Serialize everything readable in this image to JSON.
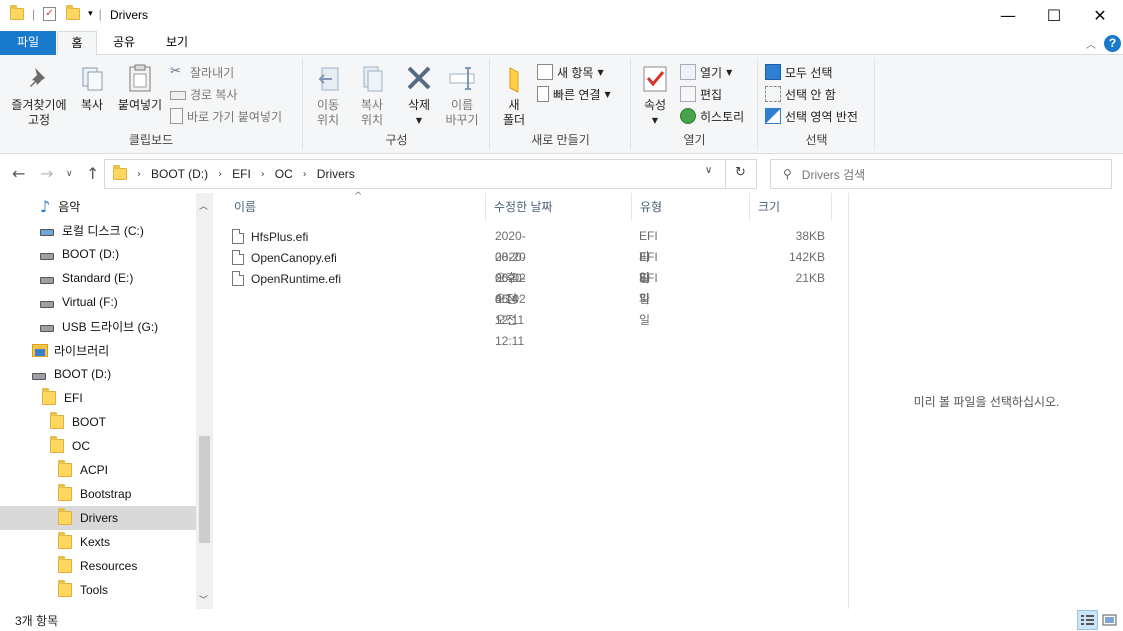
{
  "window": {
    "title": "Drivers",
    "minimize_glyph": "—",
    "maximize_glyph": "☐",
    "close_glyph": "✕"
  },
  "tabs": [
    {
      "label": "파일"
    },
    {
      "label": "홈"
    },
    {
      "label": "공유"
    },
    {
      "label": "보기"
    }
  ],
  "ribbon": {
    "clipboard": {
      "label": "클립보드",
      "pin_line1": "즐겨찾기에",
      "pin_line2": "고정",
      "copy": "복사",
      "paste": "붙여넣기",
      "cut": "잘라내기",
      "copy_path": "경로 복사",
      "paste_shortcut": "바로 가기 붙여넣기"
    },
    "organize": {
      "label": "구성",
      "move_line1": "이동",
      "move_line2": "위치",
      "copyto_line1": "복사",
      "copyto_line2": "위치",
      "delete": "삭제",
      "rename_line1": "이름",
      "rename_line2": "바꾸기"
    },
    "new": {
      "label": "새로 만들기",
      "new_folder_line1": "새",
      "new_folder_line2": "폴더",
      "new_item": "새 항목",
      "easy_access": "빠른 연결"
    },
    "open": {
      "label": "열기",
      "properties": "속성",
      "open": "열기",
      "edit": "편집",
      "history": "히스토리"
    },
    "select": {
      "label": "선택",
      "select_all": "모두 선택",
      "select_none": "선택 안 함",
      "invert": "선택 영역 반전"
    }
  },
  "address": {
    "crumbs": [
      "BOOT (D:)",
      "EFI",
      "OC",
      "Drivers"
    ],
    "search_placeholder": "Drivers 검색"
  },
  "nav_tree": [
    {
      "label": "음악",
      "icon": "music-icon"
    },
    {
      "label": "로컬 디스크 (C:)",
      "icon": "drive-icon"
    },
    {
      "label": "BOOT (D:)",
      "icon": "drive-icon"
    },
    {
      "label": "Standard (E:)",
      "icon": "drive-icon"
    },
    {
      "label": "Virtual (F:)",
      "icon": "drive-icon"
    },
    {
      "label": "USB 드라이브 (G:)",
      "icon": "drive-icon"
    },
    {
      "label": "라이브러리",
      "icon": "library-icon"
    },
    {
      "label": "BOOT (D:)",
      "icon": "drive-icon"
    },
    {
      "label": "EFI",
      "icon": "folder-icon"
    },
    {
      "label": "BOOT",
      "icon": "folder-icon"
    },
    {
      "label": "OC",
      "icon": "folder-icon"
    },
    {
      "label": "ACPI",
      "icon": "folder-icon"
    },
    {
      "label": "Bootstrap",
      "icon": "folder-icon"
    },
    {
      "label": "Drivers",
      "icon": "folder-icon",
      "selected": true
    },
    {
      "label": "Kexts",
      "icon": "folder-icon"
    },
    {
      "label": "Resources",
      "icon": "folder-icon"
    },
    {
      "label": "Tools",
      "icon": "folder-icon"
    }
  ],
  "columns": {
    "name": "이름",
    "date": "수정한 날짜",
    "type": "유형",
    "size": "크기"
  },
  "files": [
    {
      "name": "HfsPlus.efi",
      "date": "2020-08-20 오후 4:14",
      "type": "EFI 파일",
      "size": "38KB"
    },
    {
      "name": "OpenCanopy.efi",
      "date": "2020-06-02 오전 12:11",
      "type": "EFI 파일",
      "size": "142KB"
    },
    {
      "name": "OpenRuntime.efi",
      "date": "2020-06-02 오전 12:11",
      "type": "EFI 파일",
      "size": "21KB"
    }
  ],
  "preview_text": "미리 볼 파일을 선택하십시오.",
  "status_text": "3개 항목",
  "colors": {
    "accent": "#1979ca",
    "selection": "#d9d9d9",
    "folder": "#ffd75e"
  }
}
